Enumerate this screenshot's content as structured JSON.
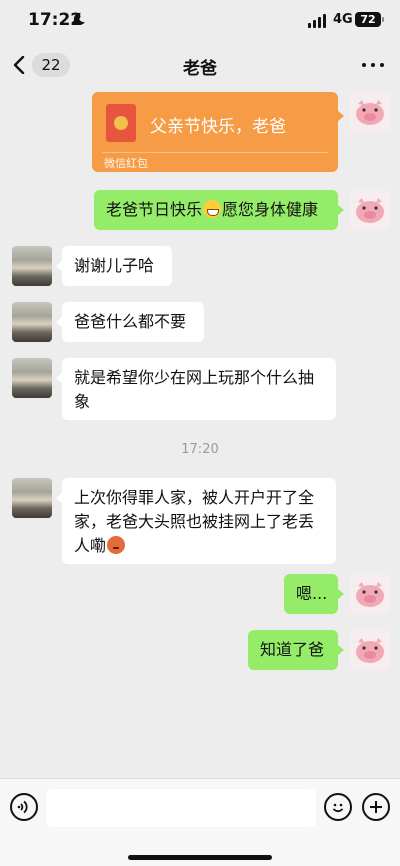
{
  "status_bar": {
    "time": "17:22",
    "network": "4G",
    "battery": "72"
  },
  "nav": {
    "unread_count": "22",
    "title": "老爸"
  },
  "messages": [
    {
      "type": "red-packet",
      "side": "right",
      "title": "父亲节快乐，老爸",
      "footer": "微信红包"
    },
    {
      "type": "text",
      "side": "right",
      "parts": [
        "老爸节日快乐",
        "愿您身体健康"
      ],
      "emoji": "grinning-emoji"
    },
    {
      "type": "text",
      "side": "left",
      "text": "谢谢儿子哈"
    },
    {
      "type": "text",
      "side": "left",
      "text": "爸爸什么都不要"
    },
    {
      "type": "text",
      "side": "left",
      "lines": [
        "就是希望你少在网上玩那个什么抽",
        "象"
      ]
    },
    {
      "type": "text",
      "side": "left",
      "lines": [
        "上次你得罪人家，被人开户开了全",
        "家，老爸大头照也被挂网上了老丢",
        "人嘞"
      ],
      "emoji": "angry-emoji"
    },
    {
      "type": "text",
      "side": "right",
      "text": "嗯..."
    },
    {
      "type": "text",
      "side": "right",
      "text": "知道了爸"
    }
  ],
  "timestamp": "17:20",
  "colors": {
    "background": "#ededed",
    "green_bubble": "#95ec69",
    "red_packet": "#f79c46"
  },
  "icons": [
    "moon-icon",
    "signal-icon",
    "back-chevron-icon",
    "more-icon",
    "voice-icon",
    "emoji-icon",
    "plus-icon"
  ]
}
